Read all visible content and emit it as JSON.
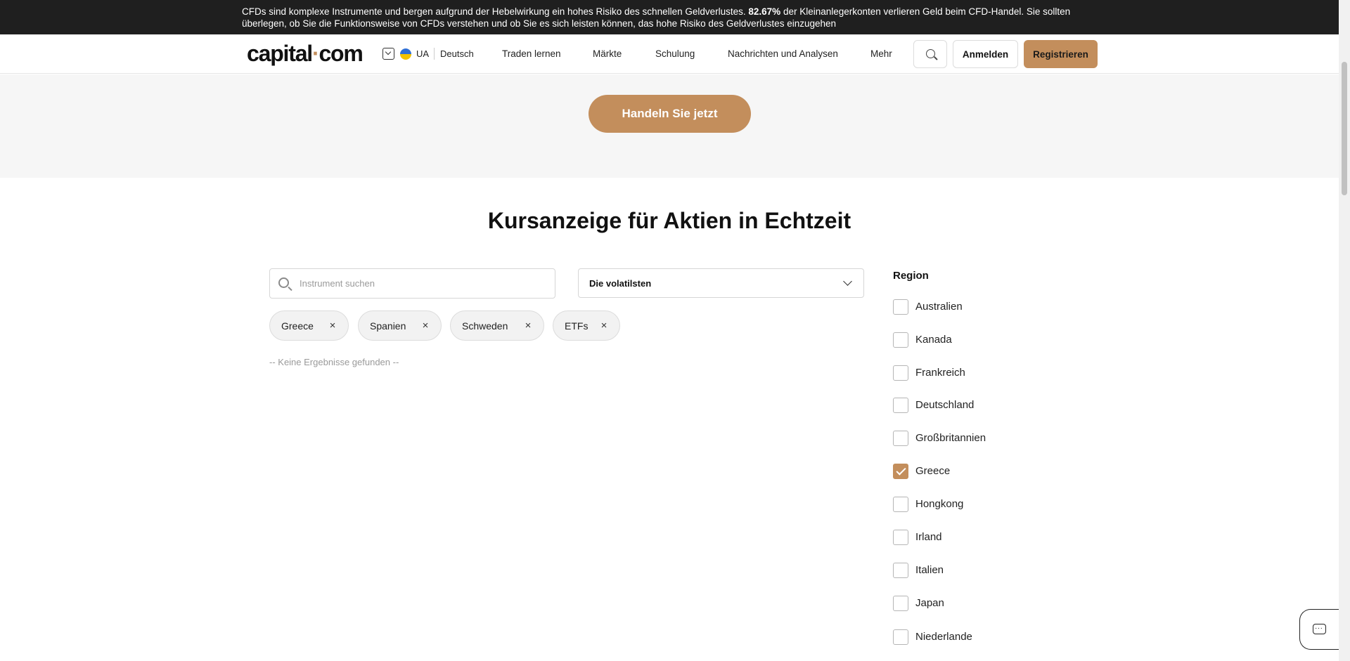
{
  "risk_banner": {
    "text_before": "CFDs sind komplexe Instrumente und bergen aufgrund der Hebelwirkung ein hohes Risiko des schnellen Geldverlustes. ",
    "percent": "82.67%",
    "text_after": " der Kleinanlegerkonten verlieren Geld beim CFD-Handel. Sie sollten überlegen, ob Sie die Funktionsweise von CFDs verstehen und ob Sie es sich leisten können, das hohe Risiko des Geldverlustes einzugehen"
  },
  "header": {
    "logo_left": "capital",
    "logo_dot": "·",
    "logo_right": "com",
    "country_code": "UA",
    "language": "Deutsch",
    "nav": [
      "Traden lernen",
      "Märkte",
      "Schulung",
      "Nachrichten und Analysen",
      "Mehr"
    ],
    "login_label": "Anmelden",
    "register_label": "Registrieren"
  },
  "cta": {
    "label": "Handeln Sie jetzt"
  },
  "main": {
    "title": "Kursanzeige für Aktien in Echtzeit",
    "search_placeholder": "Instrument suchen",
    "sort_value": "Die volatilsten",
    "chips": [
      "Greece",
      "Spanien",
      "Schweden",
      "ETFs"
    ],
    "chip_close": "×",
    "no_results": "-- Keine Ergebnisse gefunden --"
  },
  "region": {
    "title": "Region",
    "items": [
      {
        "label": "Australien",
        "checked": false
      },
      {
        "label": "Kanada",
        "checked": false
      },
      {
        "label": "Frankreich",
        "checked": false
      },
      {
        "label": "Deutschland",
        "checked": false
      },
      {
        "label": "Großbritannien",
        "checked": false
      },
      {
        "label": "Greece",
        "checked": true
      },
      {
        "label": "Hongkong",
        "checked": false
      },
      {
        "label": "Irland",
        "checked": false
      },
      {
        "label": "Italien",
        "checked": false
      },
      {
        "label": "Japan",
        "checked": false
      },
      {
        "label": "Niederlande",
        "checked": false
      }
    ]
  },
  "colors": {
    "accent": "#c38e5c",
    "banner_bg": "#1f1f1f",
    "cta_section_bg": "#f6f6f6"
  },
  "icons": {
    "search": "search-icon",
    "chat": "chat-icon",
    "dropdown": "chevron-down-icon",
    "remove": "close-icon"
  }
}
